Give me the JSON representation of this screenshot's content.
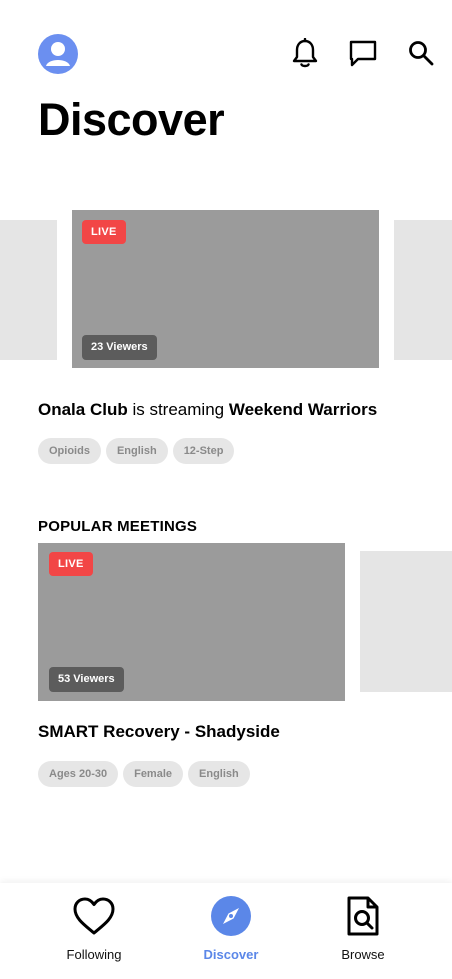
{
  "header": {
    "title": "Discover",
    "avatar_icon": "user-avatar-icon",
    "icons": [
      "bell-icon",
      "message-icon",
      "search-icon"
    ]
  },
  "featured": {
    "live_label": "LIVE",
    "viewers": "23 Viewers",
    "host": "Onala Club",
    "connector": " is streaming ",
    "meeting": "Weekend Warriors",
    "tags": [
      "Opioids",
      "English",
      "12-Step"
    ]
  },
  "popular": {
    "section_title": "POPULAR MEETINGS",
    "live_label": "LIVE",
    "viewers": "53 Viewers",
    "title": "SMART Recovery - Shadyside",
    "tags": [
      "Ages 20-30",
      "Female",
      "English"
    ]
  },
  "bottom_nav": {
    "items": [
      {
        "label": "Following",
        "icon": "heart-icon",
        "active": false
      },
      {
        "label": "Discover",
        "icon": "compass-icon",
        "active": true
      },
      {
        "label": "Browse",
        "icon": "document-search-icon",
        "active": false
      }
    ]
  },
  "colors": {
    "accent": "#5b87e8",
    "live": "#f24646",
    "placeholder": "#9b9b9b",
    "ghost": "#e5e5e5",
    "tag_bg": "#e6e6e6"
  }
}
